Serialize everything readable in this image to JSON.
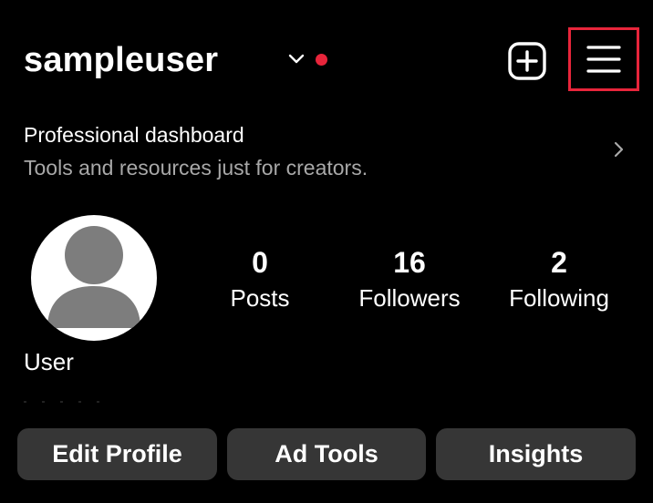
{
  "header": {
    "username": "sampleuser",
    "has_notification": true
  },
  "professional_dashboard": {
    "title": "Professional dashboard",
    "subtitle": "Tools and resources just for creators."
  },
  "profile": {
    "display_name": "User",
    "stats": [
      {
        "value": "0",
        "label": "Posts"
      },
      {
        "value": "16",
        "label": "Followers"
      },
      {
        "value": "2",
        "label": "Following"
      }
    ]
  },
  "actions": {
    "edit_profile": "Edit Profile",
    "ad_tools": "Ad Tools",
    "insights": "Insights"
  },
  "colors": {
    "background": "#000000",
    "highlight": "#e8253b",
    "button_bg": "#363636",
    "secondary_text": "#a8a8a8"
  },
  "icons": [
    "chevron-down-icon",
    "new-post-icon",
    "hamburger-menu-icon",
    "chevron-right-icon",
    "default-avatar-icon"
  ]
}
